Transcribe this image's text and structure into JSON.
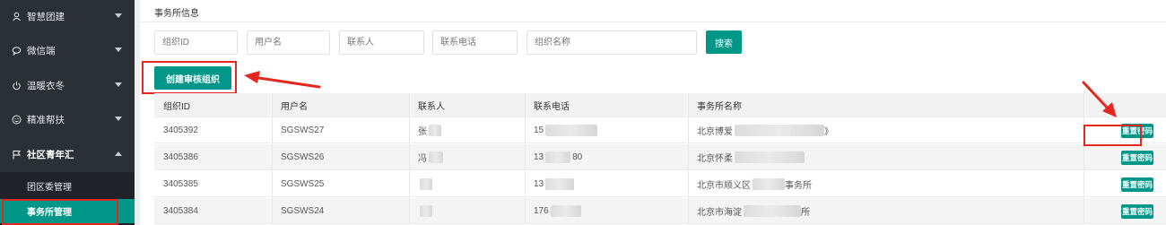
{
  "sidebar": {
    "items": [
      {
        "label": "智慧团建",
        "icon": "user-group-icon"
      },
      {
        "label": "微信端",
        "icon": "wechat-icon"
      },
      {
        "label": "温暖衣冬",
        "icon": "power-icon"
      },
      {
        "label": "精准帮扶",
        "icon": "smile-icon"
      },
      {
        "label": "社区青年汇",
        "icon": "flag-icon"
      }
    ],
    "submenu": [
      {
        "label": "团区委管理"
      },
      {
        "label": "事务所管理"
      }
    ]
  },
  "main": {
    "title": "事务所信息",
    "filters": {
      "org_id": "组织ID",
      "username": "用户名",
      "contact": "联系人",
      "phone": "联系电话",
      "org_name": "组织名称"
    },
    "search_label": "搜索",
    "create_label": "创建审核组织"
  },
  "table": {
    "headers": [
      "组织ID",
      "用户名",
      "联系人",
      "联系电话",
      "事务所名称",
      ""
    ],
    "rows": [
      {
        "id": "3405392",
        "username": "SGSWS27",
        "contact": "张",
        "phone": "15",
        "name": "北京博爱",
        "name_tail": "》"
      },
      {
        "id": "3405386",
        "username": "SGSWS26",
        "contact": "冯",
        "phone": "13",
        "phone_tail": "80",
        "name": "北京怀柔",
        "name_tail": ""
      },
      {
        "id": "3405385",
        "username": "SGSWS25",
        "contact": "",
        "phone": "13",
        "name": "北京市顺义区",
        "name_tail": "事务所"
      },
      {
        "id": "3405384",
        "username": "SGSWS24",
        "contact": "",
        "phone": "176",
        "name": "北京市海淀",
        "name_tail": "所"
      }
    ],
    "reset_label": "重置密码"
  },
  "colors": {
    "accent": "#009688",
    "sidebar_bg": "#2b2f36",
    "annotation": "#e5281f"
  }
}
